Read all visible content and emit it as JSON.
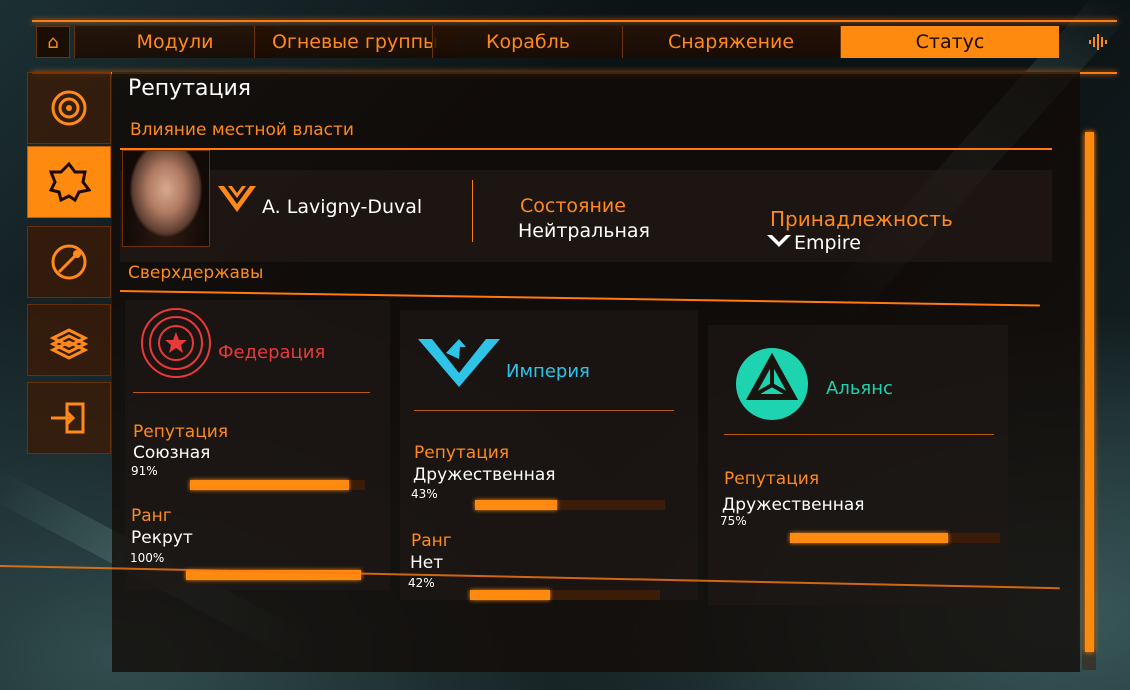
{
  "nav": {
    "tabs": [
      "Модули",
      "Огневые группы",
      "Корабль",
      "Снаряжение",
      "Статус"
    ],
    "active_tab": "Статус"
  },
  "sidebar": {
    "items": [
      "system-map-icon",
      "reputation-icon",
      "engineer-icon",
      "credits-icon",
      "exit-icon"
    ],
    "active_index": 1
  },
  "page": {
    "title": "Репутация",
    "local_section": "Влияние местной власти",
    "powers_section": "Сверхдержавы"
  },
  "minor_faction": {
    "name": "A. Lavigny-Duval",
    "state_label": "Состояние",
    "state_value": "Нейтральная",
    "allegiance_label": "Принадлежность",
    "allegiance_value": "Empire"
  },
  "superpowers": [
    {
      "name": "Федерация",
      "color": "#e83a3a",
      "reputation_label": "Репутация",
      "reputation_value": "Союзная",
      "reputation_percent": "91%",
      "reputation_fraction": 0.91,
      "rank_label": "Ранг",
      "rank_value": "Рекрут",
      "rank_percent": "100%",
      "rank_fraction": 1.0
    },
    {
      "name": "Империя",
      "color": "#2ec4e8",
      "reputation_label": "Репутация",
      "reputation_value": "Дружественная",
      "reputation_percent": "43%",
      "reputation_fraction": 0.43,
      "rank_label": "Ранг",
      "rank_value": "Нет",
      "rank_percent": "42%",
      "rank_fraction": 0.42
    },
    {
      "name": "Альянс",
      "color": "#1ed3b0",
      "reputation_label": "Репутация",
      "reputation_value": "Дружественная",
      "reputation_percent": "75%",
      "reputation_fraction": 0.75
    }
  ],
  "colors": {
    "accent": "#ff8a10"
  }
}
